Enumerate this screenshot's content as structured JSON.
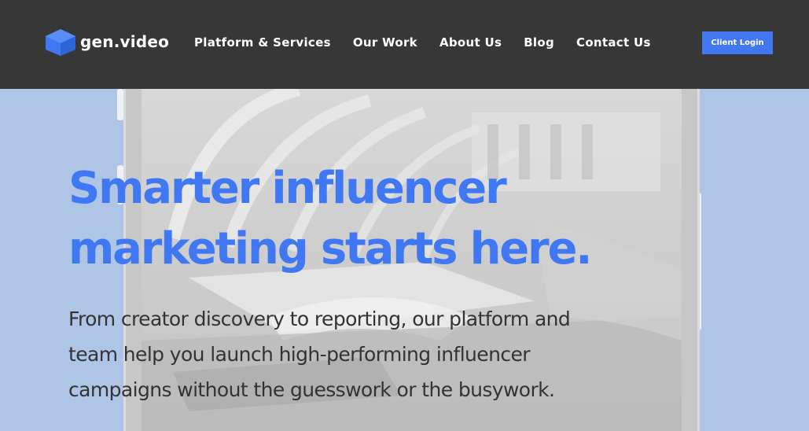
{
  "brand": {
    "logo_text": "gen.video",
    "accent_color": "#3f78f2"
  },
  "nav": {
    "items": [
      {
        "label": "Platform & Services"
      },
      {
        "label": "Our Work"
      },
      {
        "label": "About Us"
      },
      {
        "label": "Blog"
      },
      {
        "label": "Contact Us"
      }
    ],
    "login_label": "Client Login"
  },
  "hero": {
    "title_line1": "Smarter influencer",
    "title_line2": "marketing starts here.",
    "subtitle_line1": "From creator discovery to reporting, our platform and",
    "subtitle_line2": "team help you launch high-performing influencer",
    "subtitle_line3": "campaigns without the guesswork or the busywork."
  },
  "icons": {
    "logo": "cube-logo-icon"
  }
}
